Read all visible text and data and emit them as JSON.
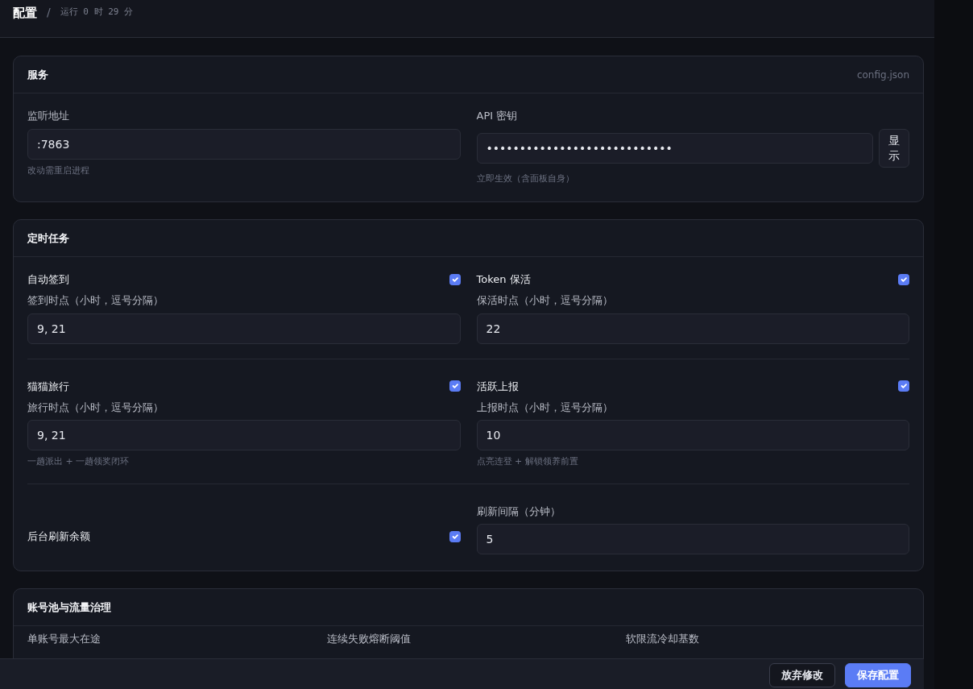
{
  "header": {
    "title": "配置",
    "separator": "/",
    "uptime": "运行 0 时 29 分"
  },
  "sections": [
    {
      "kind": "service",
      "title": "服务",
      "meta": "config.json",
      "fields": [
        {
          "label": "监听地址",
          "value": ":7863",
          "hint": "改动需重启进程"
        },
        {
          "label": "API 密钥",
          "value": "••••••••••••••••••••••••••••",
          "hint": "立即生效（含面板自身）",
          "button": "显示"
        }
      ]
    },
    {
      "kind": "tasks",
      "title": "定时任务",
      "rows": [
        [
          {
            "kind": "task",
            "title": "自动签到",
            "checked": true,
            "label": "签到时点（小时，逗号分隔）",
            "value": "9, 21"
          },
          {
            "kind": "task",
            "title": "Token 保活",
            "checked": true,
            "label": "保活时点（小时，逗号分隔）",
            "value": "22"
          }
        ],
        [
          {
            "kind": "task",
            "title": "猫猫旅行",
            "checked": true,
            "label": "旅行时点（小时，逗号分隔）",
            "value": "9, 21",
            "hint": "一趟派出 + 一趟领奖闭环"
          },
          {
            "kind": "task",
            "title": "活跃上报",
            "checked": true,
            "label": "上报时点（小时，逗号分隔）",
            "value": "10",
            "hint": "点亮连登 + 解锁领养前置"
          }
        ],
        [
          {
            "kind": "toggle",
            "title": "后台刷新余额",
            "checked": true
          },
          {
            "kind": "field",
            "label": "刷新间隔（分钟）",
            "value": "5"
          }
        ]
      ]
    },
    {
      "kind": "pool",
      "title": "账号池与流量治理",
      "labels": [
        "单账号最大在途",
        "连续失败熔断阈值",
        "软限流冷却基数"
      ]
    }
  ],
  "footer": {
    "buttons": [
      {
        "label": "放弃修改",
        "kind": "secondary"
      },
      {
        "label": "保存配置",
        "kind": "primary"
      }
    ]
  }
}
